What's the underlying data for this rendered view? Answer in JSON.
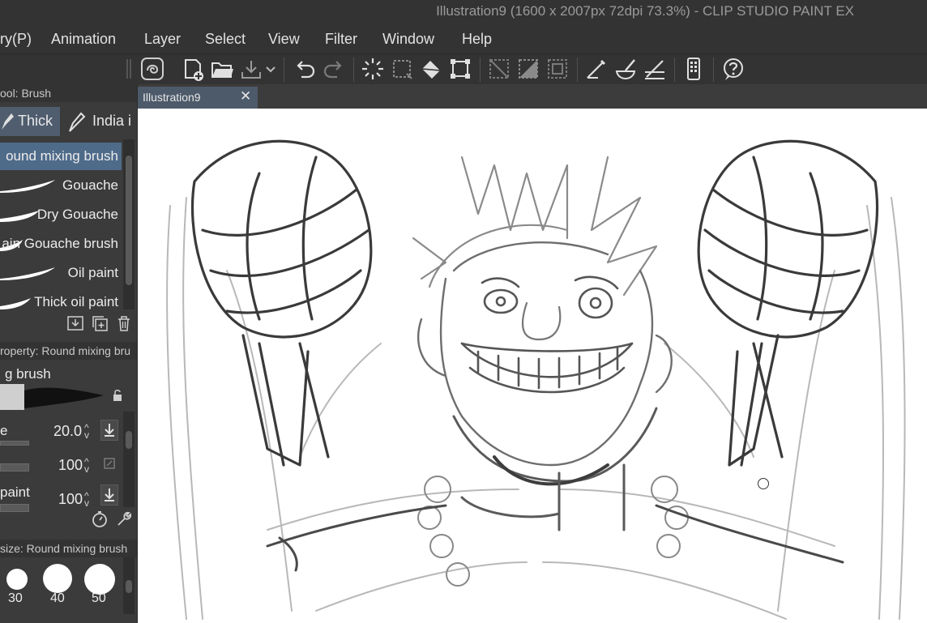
{
  "window": {
    "title": "Illustration9 (1600 x 2007px 72dpi 73.3%)  - CLIP STUDIO PAINT EX"
  },
  "menu": [
    "ry(P)",
    "Animation",
    "Layer",
    "Select",
    "View",
    "Filter",
    "Window",
    "Help"
  ],
  "toolbar": {
    "icons": [
      "swirl-logo-icon",
      "new-file-icon",
      "open-folder-icon",
      "save-icon",
      "dropdown-chevron-icon",
      "undo-icon",
      "redo-icon",
      "loading-spinner-icon",
      "clear-selection-icon",
      "fill-icon",
      "transform-icon",
      "selection-out-icon",
      "fill-selection-icon",
      "invert-selection-icon",
      "pen-line-icon",
      "brush-stroke-icon",
      "ruler-pen-icon",
      "device-icon",
      "help-icon"
    ]
  },
  "document_tab": {
    "label": "Illustration9",
    "close": "✕"
  },
  "sub_tool_panel": {
    "header": "ool: Brush",
    "tabs": [
      {
        "label": "Thick",
        "active": true
      },
      {
        "label": "India i",
        "active": false
      }
    ],
    "brushes": [
      {
        "label": "ound mixing brush",
        "selected": true
      },
      {
        "label": "Gouache",
        "selected": false
      },
      {
        "label": "Dry Gouache",
        "selected": false
      },
      {
        "label": "ain Gouache brush",
        "selected": false
      },
      {
        "label": "Oil paint",
        "selected": false
      },
      {
        "label": "Thick oil paint",
        "selected": false
      }
    ]
  },
  "tool_property": {
    "header": "roperty: Round mixing bru",
    "brush_name": "g brush",
    "rows": [
      {
        "label": "e",
        "value": "20.0"
      },
      {
        "label": "",
        "value": "100"
      },
      {
        "label": " paint",
        "value": "100"
      }
    ]
  },
  "brush_size": {
    "header": "size: Round mixing brush",
    "sizes": [
      "30",
      "40",
      "50"
    ]
  }
}
